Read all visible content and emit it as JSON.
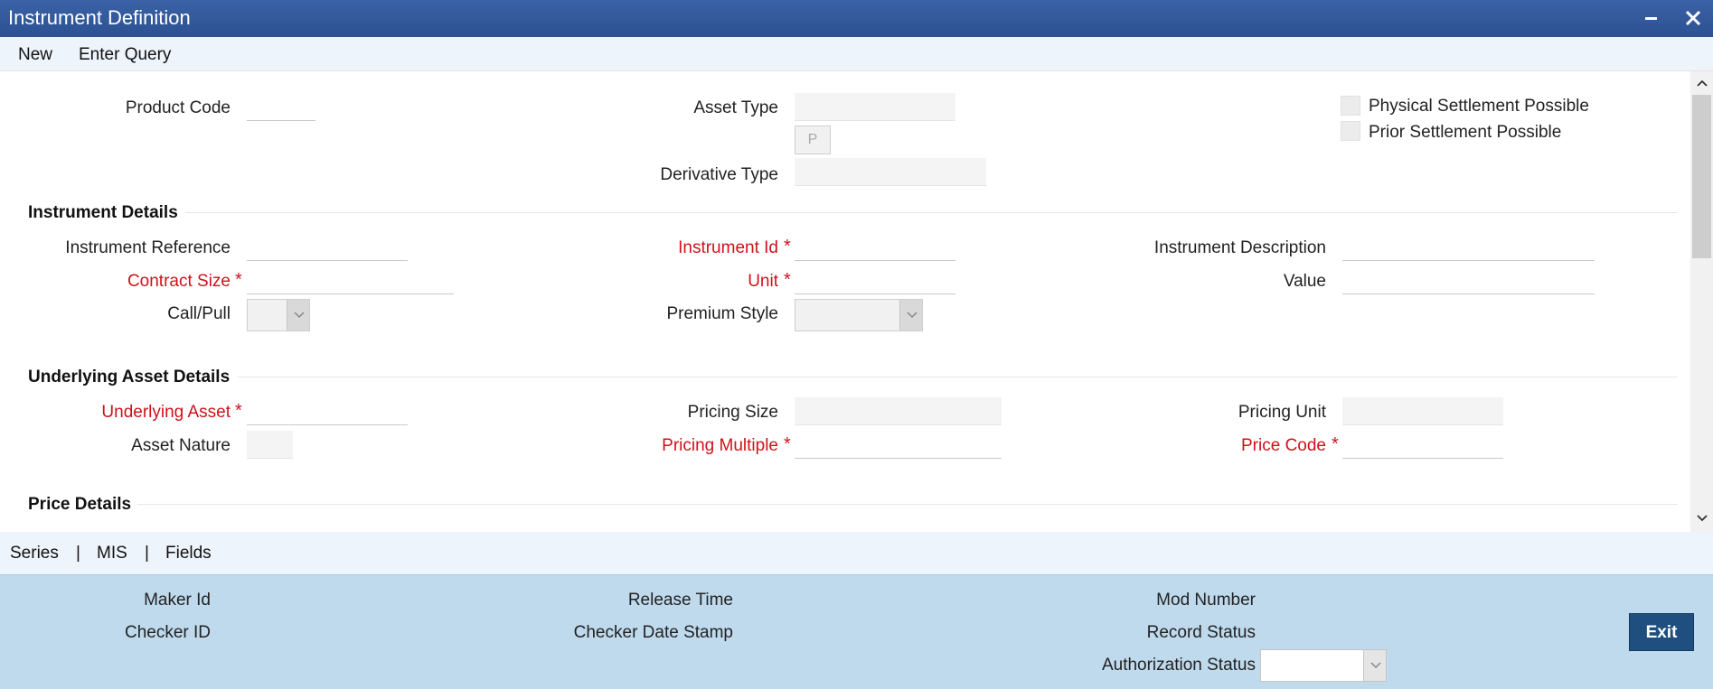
{
  "window": {
    "title": "Instrument Definition"
  },
  "menu": {
    "new": "New",
    "enter_query": "Enter Query"
  },
  "header_fields": {
    "product_code": "Product Code",
    "asset_type": "Asset Type",
    "asset_type_button": "P",
    "derivative_type": "Derivative Type",
    "physical_settlement": "Physical Settlement Possible",
    "prior_settlement": "Prior Settlement Possible"
  },
  "instrument_details": {
    "heading": "Instrument Details",
    "instrument_reference": "Instrument Reference",
    "instrument_id": "Instrument Id",
    "instrument_description": "Instrument Description",
    "contract_size": "Contract Size",
    "unit": "Unit",
    "value": "Value",
    "call_pull": "Call/Pull",
    "premium_style": "Premium Style"
  },
  "underlying_asset_details": {
    "heading": "Underlying Asset Details",
    "underlying_asset": "Underlying Asset",
    "pricing_size": "Pricing Size",
    "pricing_unit": "Pricing Unit",
    "asset_nature": "Asset Nature",
    "pricing_multiple": "Pricing Multiple",
    "price_code": "Price Code"
  },
  "price_details": {
    "heading": "Price Details"
  },
  "required_marker": "*",
  "tabs": {
    "series": "Series",
    "mis": "MIS",
    "fields": "Fields",
    "separator": "|"
  },
  "footer": {
    "maker_id": "Maker Id",
    "checker_id": "Checker ID",
    "release_time": "Release Time",
    "checker_date_stamp": "Checker Date Stamp",
    "mod_number": "Mod Number",
    "record_status": "Record Status",
    "authorization_status": "Authorization Status",
    "exit": "Exit"
  },
  "colors": {
    "titlebar": "#2d5191",
    "required": "#d0111b",
    "footer_bg": "#bfdaed",
    "exit_button": "#1e4f7e"
  }
}
